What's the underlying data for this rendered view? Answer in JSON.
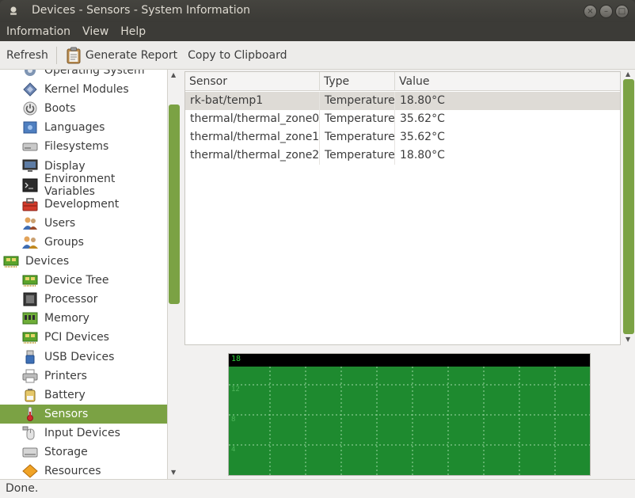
{
  "window": {
    "title": "Devices - Sensors - System Information",
    "buttons": [
      "×",
      "–",
      "□"
    ]
  },
  "menubar": [
    "Information",
    "View",
    "Help"
  ],
  "toolbar": {
    "refresh": "Refresh",
    "generate_report": "Generate Report",
    "copy_to_clipboard": "Copy to Clipboard"
  },
  "sidebar": {
    "items": [
      {
        "label": "Operating System",
        "icon": "os-icon",
        "level": 1
      },
      {
        "label": "Kernel Modules",
        "icon": "kernel-icon",
        "level": 1
      },
      {
        "label": "Boots",
        "icon": "power-icon",
        "level": 1
      },
      {
        "label": "Languages",
        "icon": "flag-icon",
        "level": 1
      },
      {
        "label": "Filesystems",
        "icon": "drive-icon",
        "level": 1
      },
      {
        "label": "Display",
        "icon": "monitor-icon",
        "level": 1
      },
      {
        "label": "Environment Variables",
        "icon": "terminal-icon",
        "level": 1
      },
      {
        "label": "Development",
        "icon": "toolbox-icon",
        "level": 1
      },
      {
        "label": "Users",
        "icon": "users-icon",
        "level": 1
      },
      {
        "label": "Groups",
        "icon": "groups-icon",
        "level": 1
      },
      {
        "label": "Devices",
        "icon": "board-icon",
        "level": 0
      },
      {
        "label": "Device Tree",
        "icon": "board-icon",
        "level": 1
      },
      {
        "label": "Processor",
        "icon": "cpu-icon",
        "level": 1
      },
      {
        "label": "Memory",
        "icon": "memory-icon",
        "level": 1
      },
      {
        "label": "PCI Devices",
        "icon": "board-icon",
        "level": 1
      },
      {
        "label": "USB Devices",
        "icon": "usb-icon",
        "level": 1
      },
      {
        "label": "Printers",
        "icon": "printer-icon",
        "level": 1
      },
      {
        "label": "Battery",
        "icon": "battery-icon",
        "level": 1
      },
      {
        "label": "Sensors",
        "icon": "thermometer-icon",
        "level": 1,
        "selected": true
      },
      {
        "label": "Input Devices",
        "icon": "mouse-icon",
        "level": 1
      },
      {
        "label": "Storage",
        "icon": "storage-icon",
        "level": 1
      },
      {
        "label": "Resources",
        "icon": "resources-icon",
        "level": 1
      }
    ]
  },
  "table": {
    "columns": [
      "Sensor",
      "Type",
      "Value"
    ],
    "rows": [
      {
        "sensor": "rk-bat/temp1",
        "type": "Temperature",
        "value": "18.80°C",
        "selected": true
      },
      {
        "sensor": "thermal/thermal_zone0",
        "type": "Temperature",
        "value": "35.62°C"
      },
      {
        "sensor": "thermal/thermal_zone1",
        "type": "Temperature",
        "value": "35.62°C"
      },
      {
        "sensor": "thermal/thermal_zone2",
        "type": "Temperature",
        "value": "18.80°C"
      }
    ]
  },
  "graph": {
    "top_label": "18",
    "ticks": [
      "12",
      "8",
      "4"
    ],
    "colors": {
      "background": "#1e8a2f",
      "grid": "#9fd8a6",
      "header": "#000000"
    }
  },
  "status": "Done.",
  "colors": {
    "accent": "#7ba244",
    "titlebar": "#3c3b37"
  }
}
